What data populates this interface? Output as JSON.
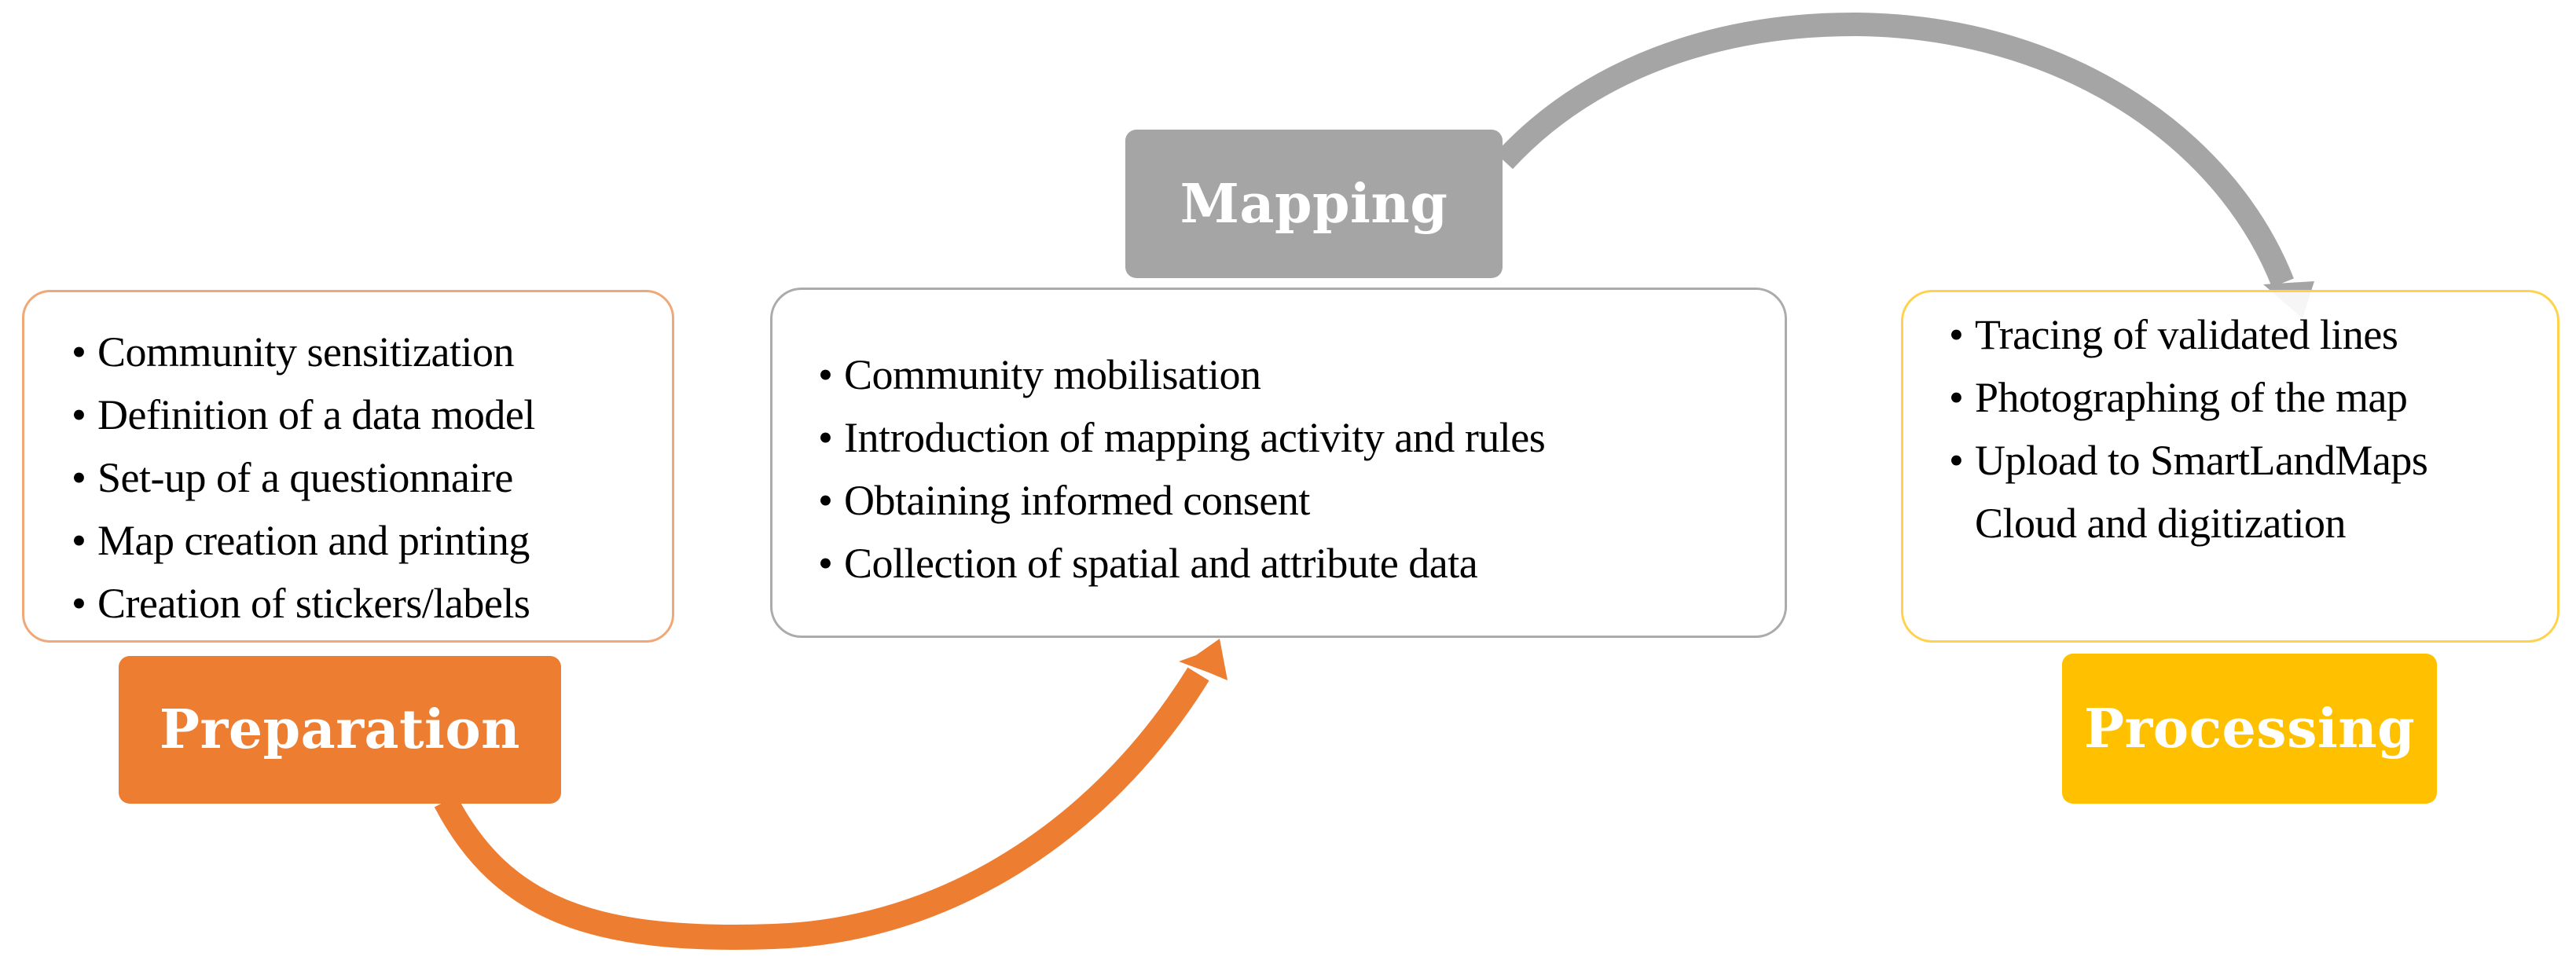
{
  "diagram": {
    "type": "process-flow",
    "colors": {
      "preparation": "#ED7D31",
      "mapping": "#A5A5A5",
      "processing": "#FFC000",
      "text": "#000000",
      "label_text": "#FFFFFF"
    },
    "bullet": "•",
    "stages": [
      {
        "id": "preparation",
        "label": "Preparation",
        "items": [
          "Community sensitization",
          "Definition of a data model",
          "Set-up of a questionnaire",
          "Map creation and printing",
          "Creation of stickers/labels"
        ]
      },
      {
        "id": "mapping",
        "label": "Mapping",
        "items": [
          "Community mobilisation",
          "Introduction of mapping activity and rules",
          "Obtaining informed consent",
          "Collection of spatial and attribute data"
        ]
      },
      {
        "id": "processing",
        "label": "Processing",
        "items": [
          "Tracing of validated lines",
          "Photographing of the map",
          "Upload to SmartLandMaps",
          "Cloud and digitization"
        ]
      }
    ],
    "connections": [
      {
        "from": "preparation",
        "to": "mapping",
        "color": "#ED7D31"
      },
      {
        "from": "mapping",
        "to": "processing",
        "color": "#A5A5A5"
      }
    ]
  }
}
